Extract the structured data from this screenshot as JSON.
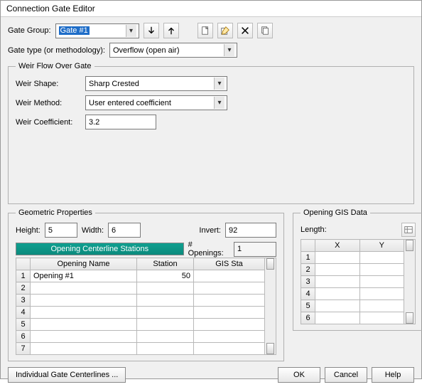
{
  "window": {
    "title": "Connection Gate Editor"
  },
  "gate_group": {
    "label": "Gate Group:",
    "value": "Gate #1"
  },
  "toolbar_icons": {
    "move_down": "move-down-icon",
    "move_up": "move-up-icon",
    "new": "new-icon",
    "delete_item": "cut-icon",
    "delete": "delete-icon",
    "copy": "copy-icon"
  },
  "gate_type": {
    "label": "Gate type (or methodology):",
    "value": "Overflow (open air)"
  },
  "weir": {
    "legend": "Weir Flow Over Gate",
    "shape_label": "Weir Shape:",
    "shape_value": "Sharp Crested",
    "method_label": "Weir Method:",
    "method_value": "User entered coefficient",
    "coef_label": "Weir Coefficient:",
    "coef_value": "3.2"
  },
  "geom": {
    "legend": "Geometric Properties",
    "height_label": "Height:",
    "height_value": "5",
    "width_label": "Width:",
    "width_value": "6",
    "invert_label": "Invert:",
    "invert_value": "92",
    "centerline_header": "Opening Centerline Stations",
    "num_openings_label": "# Openings:",
    "num_openings_value": "1",
    "columns": {
      "name": "Opening Name",
      "station": "Station",
      "gis_sta": "GIS Sta"
    },
    "rows": [
      {
        "n": "1",
        "name": "Opening #1",
        "station": "50",
        "gis": ""
      },
      {
        "n": "2",
        "name": "",
        "station": "",
        "gis": ""
      },
      {
        "n": "3",
        "name": "",
        "station": "",
        "gis": ""
      },
      {
        "n": "4",
        "name": "",
        "station": "",
        "gis": ""
      },
      {
        "n": "5",
        "name": "",
        "station": "",
        "gis": ""
      },
      {
        "n": "6",
        "name": "",
        "station": "",
        "gis": ""
      },
      {
        "n": "7",
        "name": "",
        "station": "",
        "gis": ""
      }
    ]
  },
  "gis": {
    "legend": "Opening GIS Data",
    "length_label": "Length:",
    "columns": {
      "x": "X",
      "y": "Y"
    },
    "rows": [
      {
        "n": "1",
        "x": "",
        "y": ""
      },
      {
        "n": "2",
        "x": "",
        "y": ""
      },
      {
        "n": "3",
        "x": "",
        "y": ""
      },
      {
        "n": "4",
        "x": "",
        "y": ""
      },
      {
        "n": "5",
        "x": "",
        "y": ""
      },
      {
        "n": "6",
        "x": "",
        "y": ""
      }
    ]
  },
  "footer": {
    "individual": "Individual Gate Centerlines ...",
    "ok": "OK",
    "cancel": "Cancel",
    "help": "Help"
  }
}
